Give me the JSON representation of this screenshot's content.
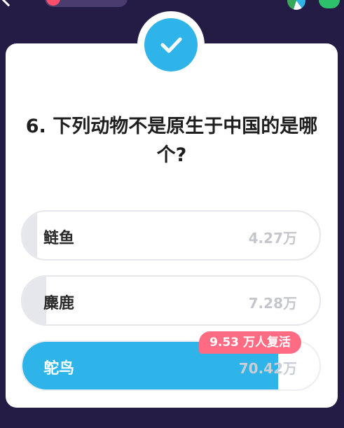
{
  "question": {
    "text": "6. 下列动物不是原生于中国的是哪个?",
    "options": [
      {
        "label": "鲢鱼",
        "count": "4.27万",
        "share": 0.05
      },
      {
        "label": "麋鹿",
        "count": "7.28万",
        "share": 0.08
      },
      {
        "label": "鸵鸟",
        "count": "70.42万",
        "share": 0.86
      }
    ],
    "correct_index": 2
  },
  "revive": {
    "value": "9.53",
    "suffix": "万人复活"
  },
  "colors": {
    "background": "#251c45",
    "accent": "#2fb4ea",
    "tag": "#ff6b82"
  },
  "icons": [
    "back-chevron-icon",
    "check-icon",
    "pie-chart-icon",
    "chat-icon"
  ]
}
